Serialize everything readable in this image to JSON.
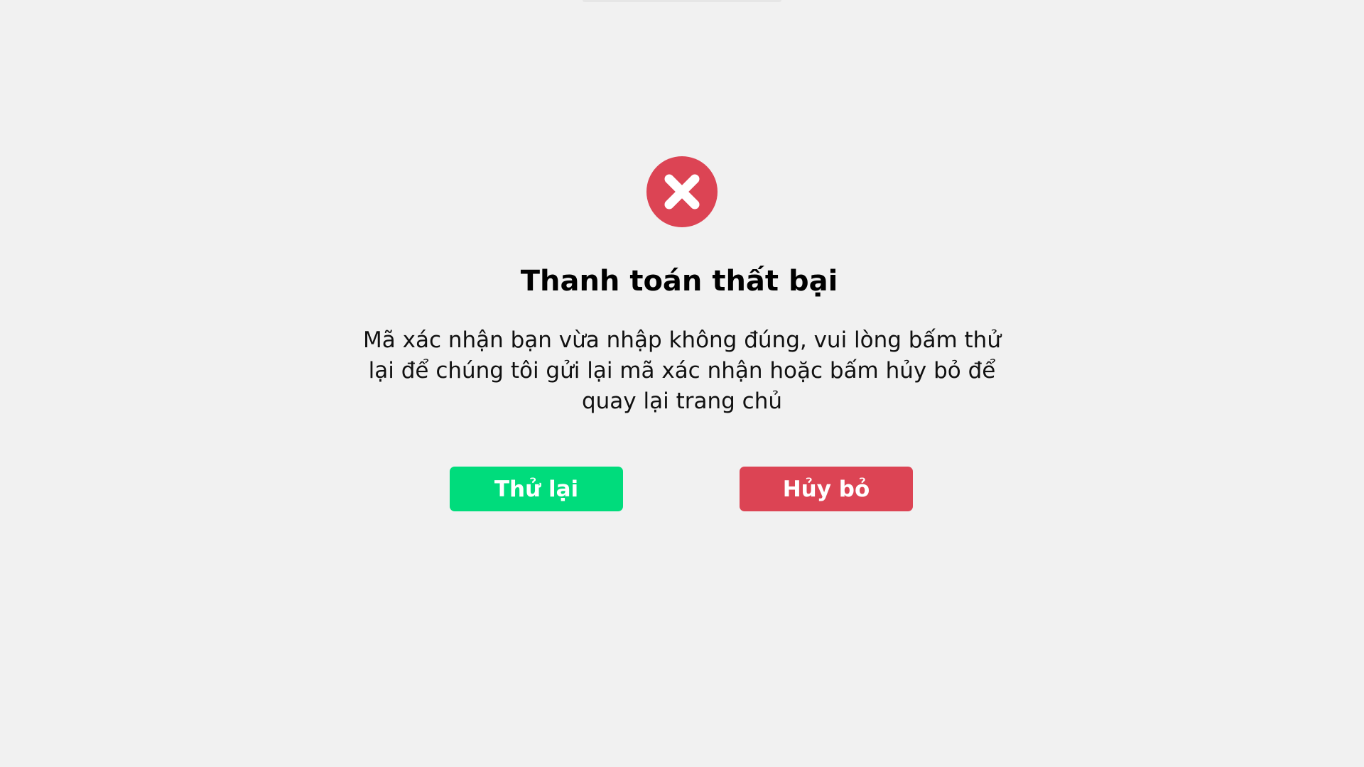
{
  "dialog": {
    "icon": "error-x-circle-icon",
    "title": "Thanh toán thất bại",
    "message": "Mã xác nhận bạn vừa nhập không đúng, vui lòng bấm thử lại để chúng tôi gửi lại mã xác nhận hoặc bấm hủy bỏ để quay lại trang chủ",
    "retry_label": "Thử lại",
    "cancel_label": "Hủy bỏ"
  },
  "colors": {
    "background": "#f1f1f1",
    "error": "#dc4454",
    "success": "#00dc7c",
    "text": "#000000"
  }
}
